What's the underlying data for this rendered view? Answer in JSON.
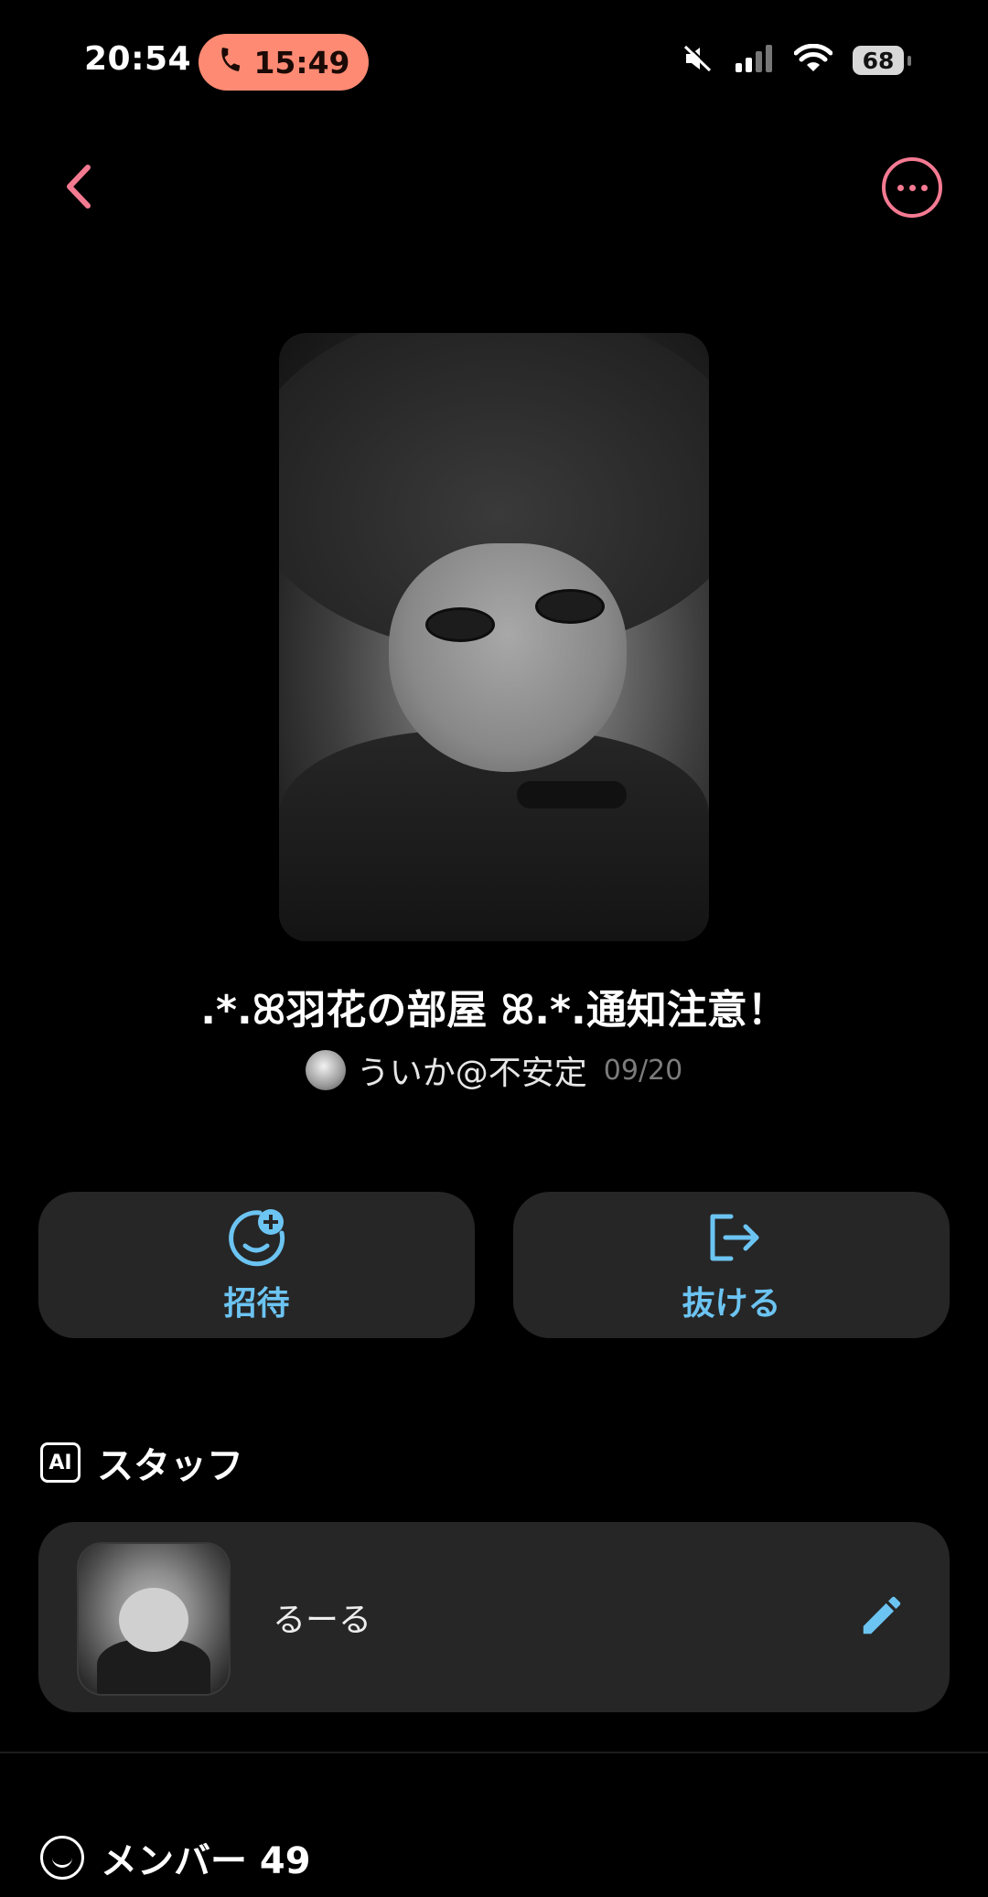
{
  "status_bar": {
    "time": "20:54",
    "call_timer": "15:49",
    "battery": "68",
    "icons": [
      "phone-icon",
      "mute-icon",
      "signal-icon",
      "wifi-icon",
      "battery-icon"
    ]
  },
  "nav": {
    "back_icon": "chevron-left-icon",
    "more_icon": "more-dots-icon"
  },
  "room": {
    "title": ".*.ꕤ羽花の部屋 ꕤ.*.通知注意！",
    "owner_name": "ういか@不安定",
    "date": "09/20"
  },
  "actions": {
    "invite_label": "招待",
    "leave_label": "抜ける"
  },
  "staff_section": {
    "badge": "AI",
    "title": "スタッフ",
    "staff_name": "るーる"
  },
  "members_section": {
    "title": "メンバー 49"
  },
  "colors": {
    "accent_pink": "#f47a92",
    "accent_blue": "#6cc4f2",
    "call_pill": "#ff8a73",
    "card_bg": "#262626"
  }
}
